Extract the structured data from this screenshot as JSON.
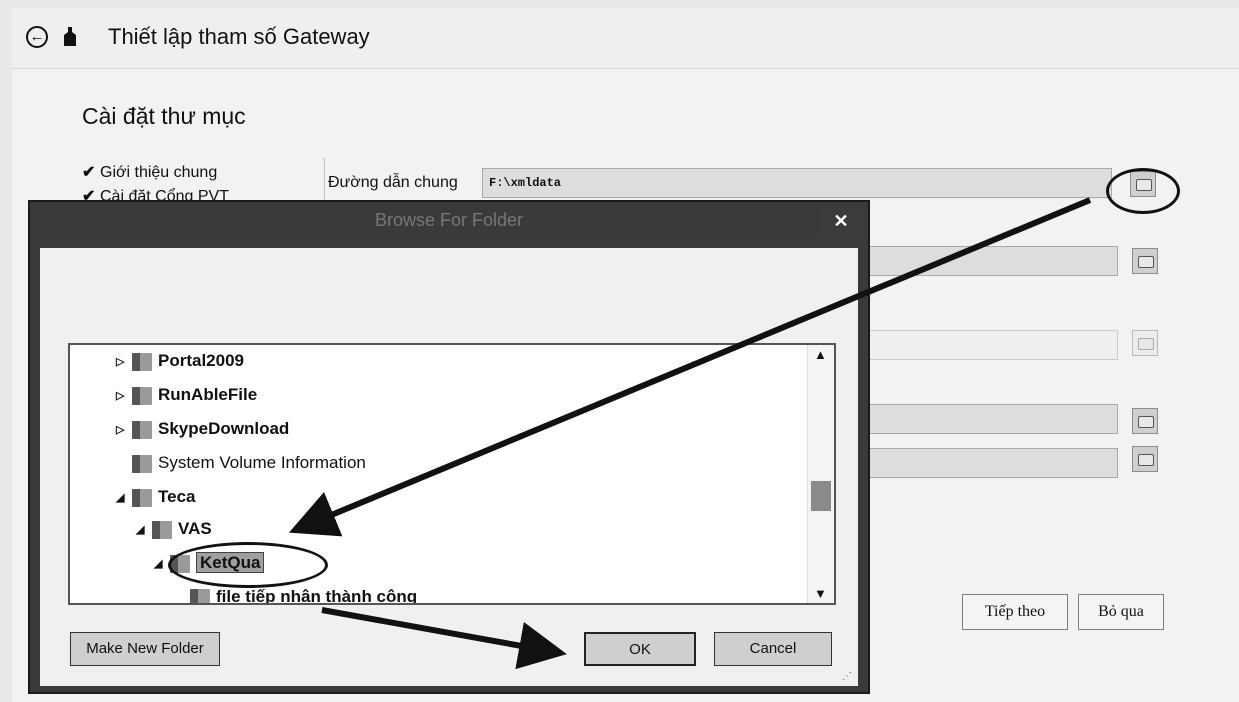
{
  "window": {
    "title": "Thiết lập tham số Gateway",
    "section_title": "Cài đặt thư mục",
    "steps": [
      "Giới thiệu chung",
      "Cài đặt Cổng PVT"
    ],
    "field_label": "Đường dẫn chung",
    "field_value": "F:\\xmldata",
    "next_label": "Tiếp theo",
    "skip_label": "Bỏ qua"
  },
  "dialog": {
    "title": "Browse For Folder",
    "close_glyph": "✕",
    "tree": [
      {
        "label": "Portal2009",
        "expander": "▷"
      },
      {
        "label": "RunAbleFile",
        "expander": "▷"
      },
      {
        "label": "SkypeDownload",
        "expander": "▷"
      },
      {
        "label": "System Volume Information",
        "expander": ""
      },
      {
        "label": "Teca",
        "expander": "◢"
      },
      {
        "label": "VAS",
        "expander": "◢"
      },
      {
        "label": "KetQua",
        "expander": "◢"
      },
      {
        "label": "file tiếp nhận thành công",
        "expander": ""
      }
    ],
    "make_new_folder_label": "Make New Folder",
    "ok_label": "OK",
    "cancel_label": "Cancel"
  },
  "icons": {
    "back": "arrow-left-circle-icon",
    "app": "app-icon",
    "folder": "folder-icon",
    "browse": "browse-folder-icon"
  }
}
